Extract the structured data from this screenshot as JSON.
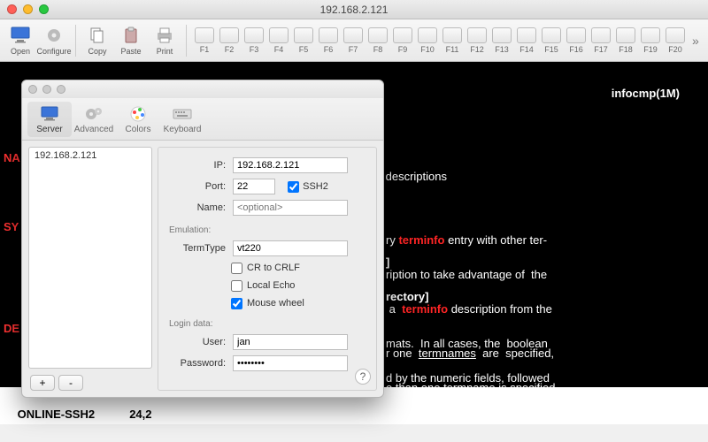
{
  "window": {
    "title": "192.168.2.121"
  },
  "toolbar": {
    "open": "Open",
    "configure": "Configure",
    "copy": "Copy",
    "paste": "Paste",
    "print": "Print",
    "fkeys": [
      "F1",
      "F2",
      "F3",
      "F4",
      "F5",
      "F6",
      "F7",
      "F8",
      "F9",
      "F10",
      "F11",
      "F12",
      "F13",
      "F14",
      "F15",
      "F16",
      "F17",
      "F18",
      "F19",
      "F20"
    ]
  },
  "terminal": {
    "top_left": "infocmp(1M)",
    "top_right": "infocmp(1M)",
    "section_name": "NA",
    "section_name_rest": "",
    "desc_frag": " descriptions",
    "section_syn": "SY",
    "syn_frag1": "]",
    "syn_frag2": "rectory",
    "section_desc": "DE",
    "body_l1a": "ry ",
    "body_l1_kw": "terminfo",
    "body_l1b": " entry with other ter-",
    "body_l2": "ription to take advantage of  the",
    "body_l3a": " a  ",
    "body_l3_kw": "terminfo",
    "body_l3b": " description from the",
    "body_l4": "mats.  In all cases, the  boolean",
    "body_l5": "d by the numeric fields, followed",
    "body_l6a": "r one  ",
    "body_l6_u": "termnames",
    "body_l6b": "  are  specified,",
    "body_l7a": "e than one ",
    "body_l7_u": "termname",
    "body_l7b": " is specified,",
    "prompt": ":",
    "status_mode": "ONLINE-SSH2",
    "status_pos": "24,2"
  },
  "dialog": {
    "tabs": {
      "server": "Server",
      "advanced": "Advanced",
      "colors": "Colors",
      "keyboard": "Keyboard"
    },
    "active_tab": "server",
    "host_list": [
      "192.168.2.121"
    ],
    "labels": {
      "ip": "IP:",
      "port": "Port:",
      "ssh2": "SSH2",
      "name": "Name:",
      "name_placeholder": "<optional>",
      "emulation": "Emulation:",
      "termtype": "TermType",
      "cr_to_crlf": "CR to CRLF",
      "local_echo": "Local Echo",
      "mouse_wheel": "Mouse wheel",
      "login_data": "Login data:",
      "user": "User:",
      "password": "Password:",
      "add": "+",
      "remove": "-",
      "help": "?"
    },
    "values": {
      "ip": "192.168.2.121",
      "port": "22",
      "ssh2": true,
      "name": "",
      "termtype": "vt220",
      "cr_to_crlf": false,
      "local_echo": false,
      "mouse_wheel": true,
      "user": "jan",
      "password": "••••••••"
    }
  },
  "icons": {
    "monitor": "monitor-icon",
    "gear": "gear-icon",
    "palette": "palette-icon",
    "keyboard": "keyboard-icon",
    "printer": "printer-icon",
    "clipboard_copy": "copy-icon",
    "clipboard_paste": "paste-icon"
  }
}
